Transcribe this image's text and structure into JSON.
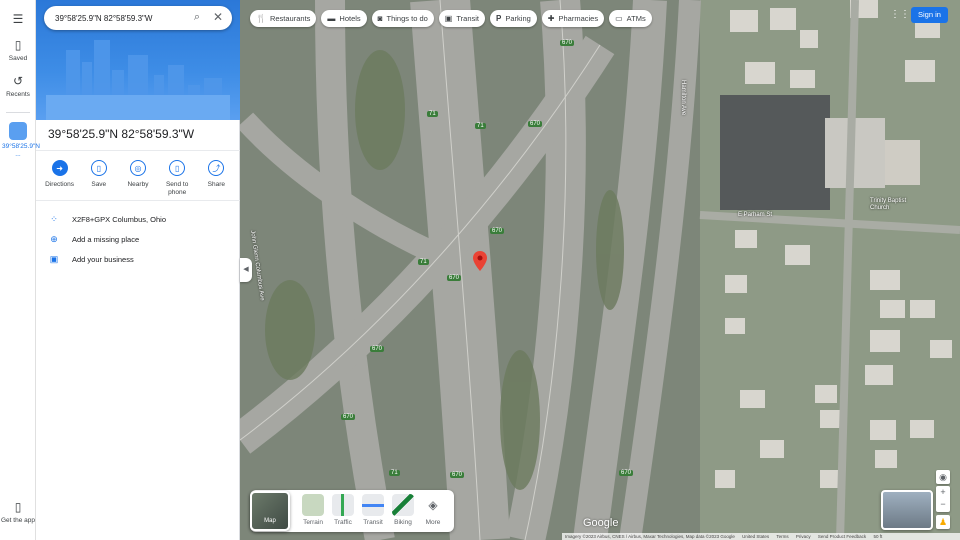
{
  "search": {
    "value": "39°58'25.9\"N 82°58'59.3\"W"
  },
  "rail": {
    "saved": "Saved",
    "recents": "Recents",
    "current": "39°58'25.9\"N ...",
    "get_app": "Get the app"
  },
  "place": {
    "title": "39°58'25.9\"N 82°58'59.3\"W",
    "actions": [
      {
        "label": "Directions",
        "icon": "directions-icon"
      },
      {
        "label": "Save",
        "icon": "bookmark-icon"
      },
      {
        "label": "Nearby",
        "icon": "nearby-icon"
      },
      {
        "label": "Send to phone",
        "icon": "phone-icon"
      },
      {
        "label": "Share",
        "icon": "share-icon"
      }
    ],
    "plus_code": "X2F8+GPX Columbus, Ohio",
    "add_place": "Add a missing place",
    "add_business": "Add your business"
  },
  "chips": [
    {
      "label": "Restaurants",
      "icon": "restaurant-icon"
    },
    {
      "label": "Hotels",
      "icon": "hotel-icon"
    },
    {
      "label": "Things to do",
      "icon": "camera-icon"
    },
    {
      "label": "Transit",
      "icon": "transit-icon"
    },
    {
      "label": "Parking",
      "icon": "parking-icon"
    },
    {
      "label": "Pharmacies",
      "icon": "pharmacy-icon"
    },
    {
      "label": "ATMs",
      "icon": "atm-icon"
    }
  ],
  "header": {
    "signin": "Sign in"
  },
  "layers": {
    "map": "Map",
    "terrain": "Terrain",
    "traffic": "Traffic",
    "transit": "Transit",
    "biking": "Biking",
    "more": "More"
  },
  "map_labels": {
    "highway_670": "670",
    "highway_71": "71",
    "church": "Trinity Baptist Church",
    "parham": "E Parham St",
    "hamilton": "Hamilton Ave",
    "john_glenn": "John Glenn Columbus Ave"
  },
  "attribution": {
    "imagery": "Imagery ©2023 Airbus, CNES / Airbus, Maxar Technologies, Map data ©2023 Google",
    "country": "United States",
    "terms": "Terms",
    "privacy": "Privacy",
    "feedback": "Send Product Feedback",
    "scale": "50 ft",
    "logo": "Google"
  },
  "colors": {
    "accent": "#1a73e8",
    "pin": "#ea4335"
  }
}
